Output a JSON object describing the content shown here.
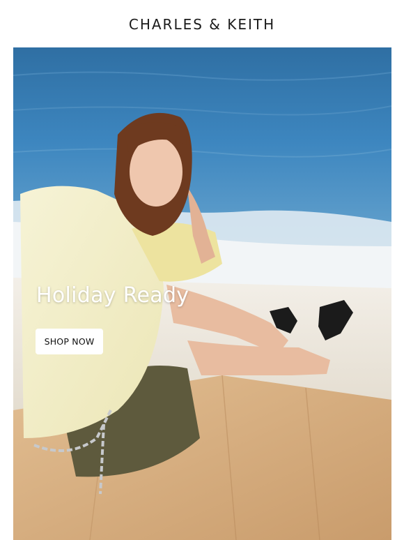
{
  "header": {
    "brand": "CHARLES & KEITH"
  },
  "hero": {
    "title": "Holiday Ready",
    "cta_label": "SHOP NOW"
  },
  "colors": {
    "sea": "#3a7fb5",
    "sand": "#e9e3d8",
    "deck": "#d9b48a",
    "button_bg": "#ffffff",
    "text_dark": "#111111"
  }
}
